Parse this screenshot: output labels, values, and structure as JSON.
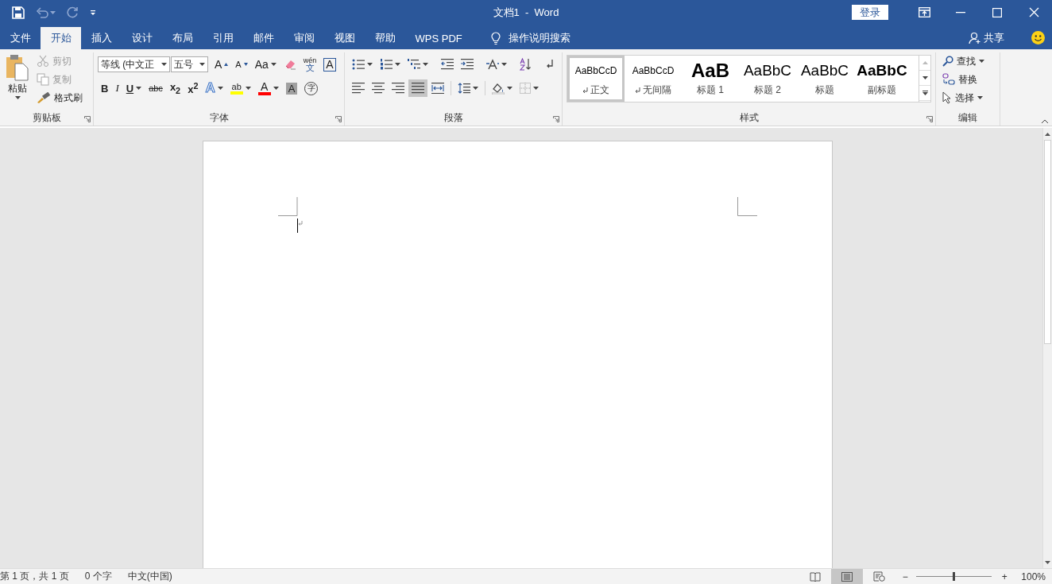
{
  "window": {
    "title": "文档1  -  Word",
    "login": "登录"
  },
  "tabs": [
    {
      "label": "文件",
      "selected": false
    },
    {
      "label": "开始",
      "selected": true
    },
    {
      "label": "插入",
      "selected": false
    },
    {
      "label": "设计",
      "selected": false
    },
    {
      "label": "布局",
      "selected": false
    },
    {
      "label": "引用",
      "selected": false
    },
    {
      "label": "邮件",
      "selected": false
    },
    {
      "label": "审阅",
      "selected": false
    },
    {
      "label": "视图",
      "selected": false
    },
    {
      "label": "帮助",
      "selected": false
    },
    {
      "label": "WPS PDF",
      "selected": false
    }
  ],
  "tell_me": "操作说明搜索",
  "share": "共享",
  "clipboard": {
    "title": "剪贴板",
    "paste": "粘贴",
    "items": [
      {
        "label": "剪切",
        "kind": "cut",
        "disabled": true
      },
      {
        "label": "复制",
        "kind": "copy",
        "disabled": true
      },
      {
        "label": "格式刷",
        "kind": "painter",
        "disabled": false
      }
    ]
  },
  "font": {
    "title": "字体",
    "name": "等线 (中文正",
    "size": "五号",
    "row1": [
      {
        "label": "A",
        "kind": "grow",
        "dropdown": false
      },
      {
        "label": "A",
        "kind": "shrink",
        "dropdown": false
      },
      {
        "label": "Aa",
        "kind": "case",
        "dropdown": true
      },
      {
        "kind": "clear",
        "dropdown": false
      },
      {
        "label": "wén",
        "sub": "文",
        "kind": "phonetic",
        "dropdown": false
      },
      {
        "label": "A",
        "kind": "border",
        "dropdown": false
      }
    ],
    "row2": [
      {
        "label": "B",
        "kind": "bold",
        "dropdown": false
      },
      {
        "label": "I",
        "kind": "italic",
        "dropdown": false
      },
      {
        "label": "U",
        "kind": "underline",
        "dropdown": true
      },
      {
        "label": "abc",
        "kind": "strike",
        "dropdown": false
      },
      {
        "label": "x$_{2}$",
        "kind": "subscript",
        "dropdown": false
      },
      {
        "label": "x$^{2}$",
        "kind": "superscript",
        "dropdown": false
      },
      {
        "label": "A",
        "kind": "effects",
        "dropdown": true
      },
      {
        "label": "ab",
        "kind": "highlight",
        "dropdown": true,
        "color": "#ffff00"
      },
      {
        "label": "A",
        "kind": "color",
        "dropdown": true,
        "color": "#ff0000"
      },
      {
        "label": "A",
        "kind": "shading",
        "dropdown": false
      },
      {
        "label": "字",
        "kind": "enclose",
        "dropdown": false
      }
    ]
  },
  "paragraph": {
    "title": "段落",
    "alignments": [
      {
        "selected": false
      },
      {
        "selected": false
      },
      {
        "selected": false
      },
      {
        "selected": true
      },
      {
        "selected": false
      }
    ]
  },
  "styles": {
    "title": "样式",
    "items": [
      {
        "preview": "AaBbCcD",
        "name": "正文",
        "kind": "normal",
        "para_mark": true,
        "selected": true
      },
      {
        "preview": "AaBbCcD",
        "name": "无间隔",
        "kind": "nospacing",
        "para_mark": true,
        "selected": false
      },
      {
        "preview": "AaB",
        "name": "标题 1",
        "kind": "h1",
        "para_mark": false,
        "selected": false
      },
      {
        "preview": "AaBbC",
        "name": "标题 2",
        "kind": "h2",
        "para_mark": false,
        "selected": false
      },
      {
        "preview": "AaBbC",
        "name": "标题",
        "kind": "title",
        "para_mark": false,
        "selected": false
      },
      {
        "preview": "AaBbC",
        "name": "副标题",
        "kind": "subtitle",
        "para_mark": false,
        "selected": false
      }
    ]
  },
  "editing": {
    "title": "编辑",
    "items": [
      {
        "label": "查找",
        "kind": "find",
        "dropdown": true
      },
      {
        "label": "替换",
        "kind": "replace",
        "dropdown": false
      },
      {
        "label": "选择",
        "kind": "select",
        "dropdown": true
      }
    ]
  },
  "status": {
    "page": "第 1 页，共 1 页",
    "words": "0 个字",
    "language": "中文(中国)",
    "views": [
      {
        "kind": "read",
        "selected": false
      },
      {
        "kind": "print",
        "selected": true
      },
      {
        "kind": "web",
        "selected": false
      }
    ],
    "zoom_out": "−",
    "zoom_in": "+",
    "zoom": {
      "level": 0.5
    },
    "zoom_text": "100%"
  }
}
